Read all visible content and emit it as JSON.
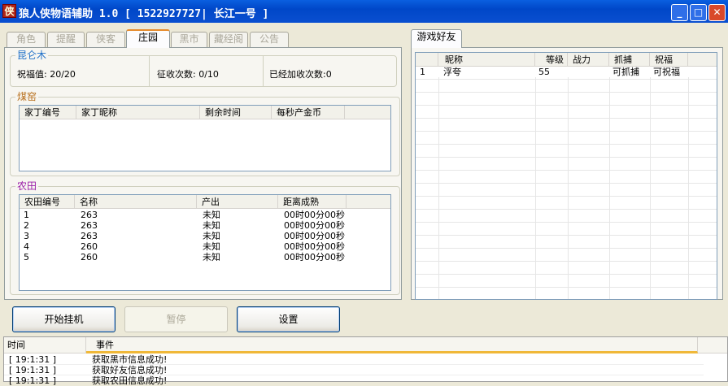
{
  "window": {
    "title": "狼人侠物语辅助 1.0  [ 1522927727| 长江一号 ]",
    "icon_char": "侠"
  },
  "tabs": [
    {
      "label": "角色"
    },
    {
      "label": "提醒"
    },
    {
      "label": "侠客"
    },
    {
      "label": "庄园",
      "active": true
    },
    {
      "label": "黑市"
    },
    {
      "label": "藏经阁"
    },
    {
      "label": "公告"
    }
  ],
  "kunlun": {
    "title": "昆仑木",
    "blessing": "祝福值: 20/20",
    "collect": "征收次数: 0/10",
    "added": "已经加收次数:0"
  },
  "mine": {
    "title": "煤窑",
    "columns": [
      "家丁编号",
      "家丁昵称",
      "剩余时间",
      "每秒产金币"
    ]
  },
  "farm": {
    "title": "农田",
    "columns": [
      "农田编号",
      "名称",
      "产出",
      "距离成熟"
    ],
    "rows": [
      [
        "1",
        "263",
        "未知",
        "00时00分00秒"
      ],
      [
        "2",
        "263",
        "未知",
        "00时00分00秒"
      ],
      [
        "3",
        "263",
        "未知",
        "00时00分00秒"
      ],
      [
        "4",
        "260",
        "未知",
        "00时00分00秒"
      ],
      [
        "5",
        "260",
        "未知",
        "00时00分00秒"
      ]
    ]
  },
  "friends": {
    "tab": "游戏好友",
    "columns": [
      "",
      "昵称",
      "等级",
      "战力",
      "抓捕",
      "祝福"
    ],
    "rows": [
      [
        "1",
        "浮夸",
        "55",
        "",
        "可抓捕",
        "可祝福"
      ]
    ]
  },
  "buttons": {
    "start": "开始挂机",
    "pause": "暂停",
    "settings": "设置"
  },
  "log": {
    "columns": [
      "时间",
      "事件"
    ],
    "rows": [
      [
        "[ 19:1:31 ]",
        "获取黑市信息成功!"
      ],
      [
        "[ 19:1:31 ]",
        "获取好友信息成功!"
      ],
      [
        "[ 19:1:31 ]",
        "获取农田信息成功!"
      ]
    ]
  }
}
